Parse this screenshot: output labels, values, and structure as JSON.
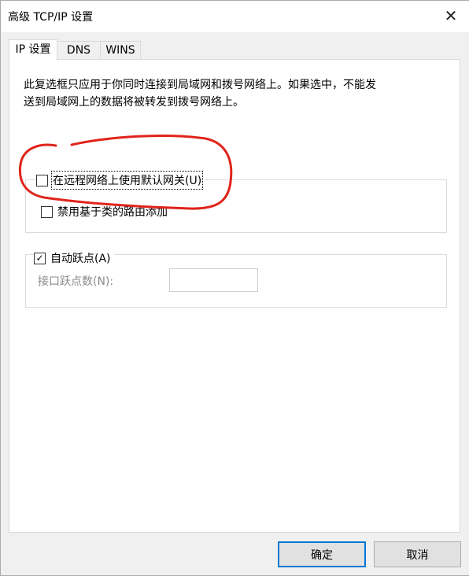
{
  "window": {
    "title": "高级 TCP/IP 设置"
  },
  "tabs": [
    {
      "label": "IP 设置",
      "active": true
    },
    {
      "label": "DNS",
      "active": false
    },
    {
      "label": "WINS",
      "active": false
    }
  ],
  "description": {
    "line1": "此复选框只应用于你同时连接到局域网和拨号网络上。如果选中，不能发",
    "line2": "送到局域网上的数据将被转发到拨号网络上。"
  },
  "gateway_group": {
    "use_default_gateway": {
      "label": "在远程网络上使用默认网关(U)",
      "checked": false
    },
    "disable_class_routes": {
      "label": "禁用基于类的路由添加",
      "checked": false
    }
  },
  "metric_group": {
    "automatic_metric": {
      "label": "自动跃点(A)",
      "checked": true
    },
    "interface_metric": {
      "label": "接口跃点数(N):",
      "value": ""
    }
  },
  "buttons": {
    "ok": "确定",
    "cancel": "取消"
  },
  "annotation": {
    "color": "#e0241b"
  }
}
